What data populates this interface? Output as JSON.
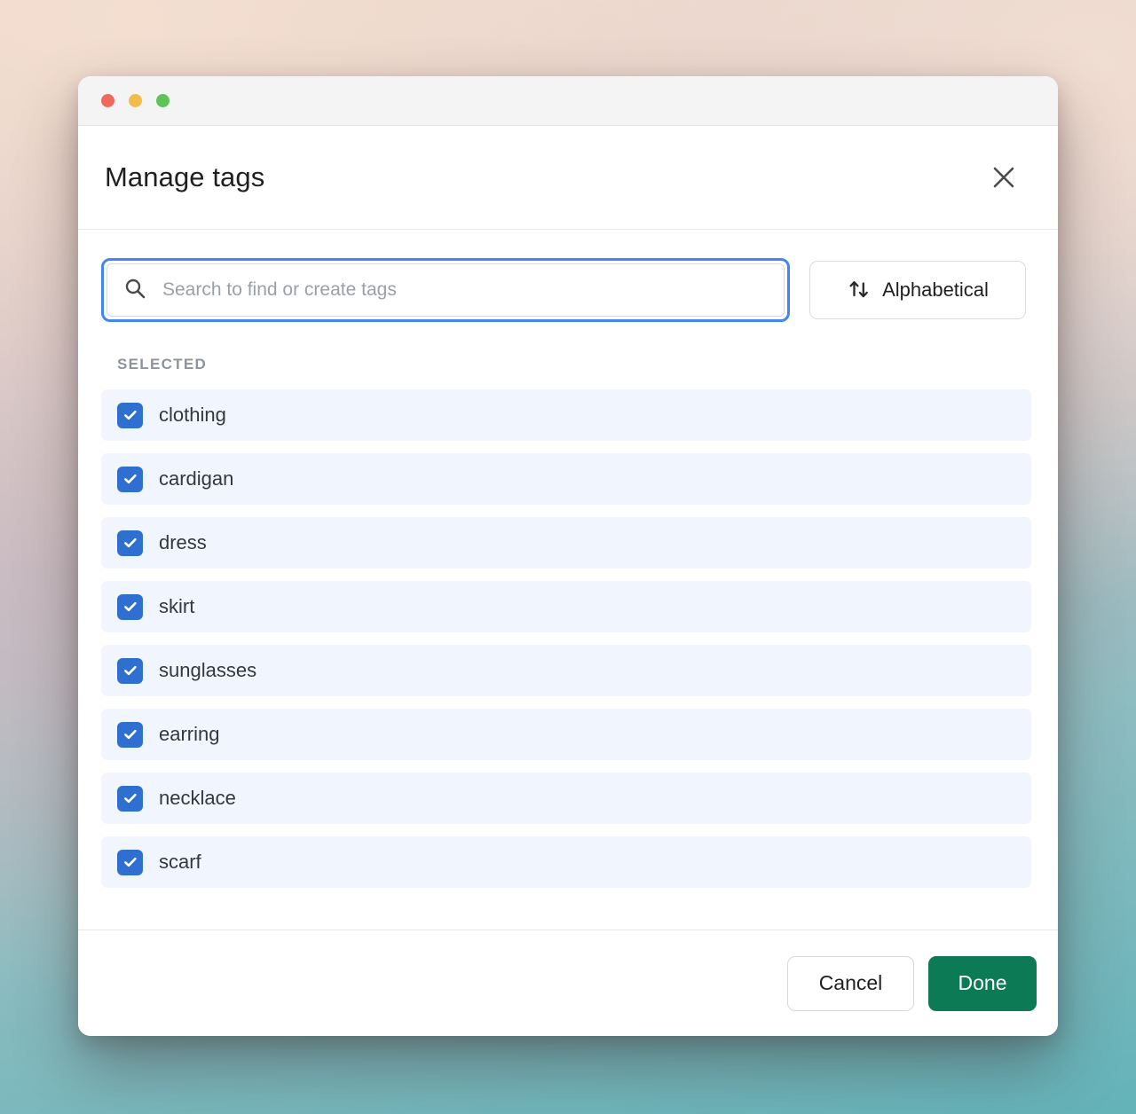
{
  "window": {
    "traffic_lights": [
      {
        "name": "close",
        "color": "#ef6a5b"
      },
      {
        "name": "minimize",
        "color": "#f2bc4b"
      },
      {
        "name": "maximize",
        "color": "#5dc356"
      }
    ]
  },
  "dialog": {
    "title": "Manage tags",
    "close_icon": "close-icon"
  },
  "search": {
    "icon": "search-icon",
    "placeholder": "Search to find or create tags",
    "value": ""
  },
  "sort": {
    "icon": "sort-arrows-icon",
    "label": "Alphabetical"
  },
  "list": {
    "section_label": "SELECTED",
    "items": [
      {
        "label": "clothing",
        "checked": true
      },
      {
        "label": "cardigan",
        "checked": true
      },
      {
        "label": "dress",
        "checked": true
      },
      {
        "label": "skirt",
        "checked": true
      },
      {
        "label": "sunglasses",
        "checked": true
      },
      {
        "label": "earring",
        "checked": true
      },
      {
        "label": "necklace",
        "checked": true
      },
      {
        "label": "scarf",
        "checked": true
      }
    ]
  },
  "footer": {
    "cancel_label": "Cancel",
    "done_label": "Done"
  },
  "colors": {
    "accent_blue": "#4285f4",
    "checkbox_blue": "#2f6fd0",
    "row_background": "#f1f5fd",
    "done_green": "#0d7a56",
    "section_label": "#8e949b"
  }
}
